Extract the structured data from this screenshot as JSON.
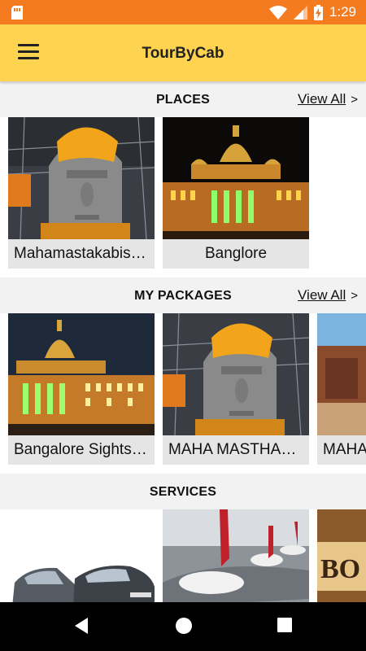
{
  "app": {
    "title": "TourByCab"
  },
  "status_bar": {
    "time": "1:29"
  },
  "places": {
    "title": "PLACES",
    "view_all": "View All",
    "items": [
      {
        "label": "Mahamastakabisheka",
        "image": "statue"
      },
      {
        "label": "Banglore",
        "image": "palace"
      }
    ]
  },
  "packages": {
    "title": "MY PACKAGES",
    "view_all": "View All",
    "items": [
      {
        "label": "Bangalore Sightseeing",
        "image": "palace"
      },
      {
        "label": "MAHA MASTHAKABISHEKA",
        "image": "statue"
      },
      {
        "label": "MAHA",
        "image": "temple"
      }
    ]
  },
  "services": {
    "title": "SERVICES",
    "items": [
      {
        "image": "cars"
      },
      {
        "image": "airport"
      },
      {
        "image": "booking"
      }
    ]
  },
  "colors": {
    "status_bar": "#f47b20",
    "app_bar": "#fdd34f",
    "section_bg": "#f2f2f2",
    "card_bg": "#e5e5e5"
  }
}
